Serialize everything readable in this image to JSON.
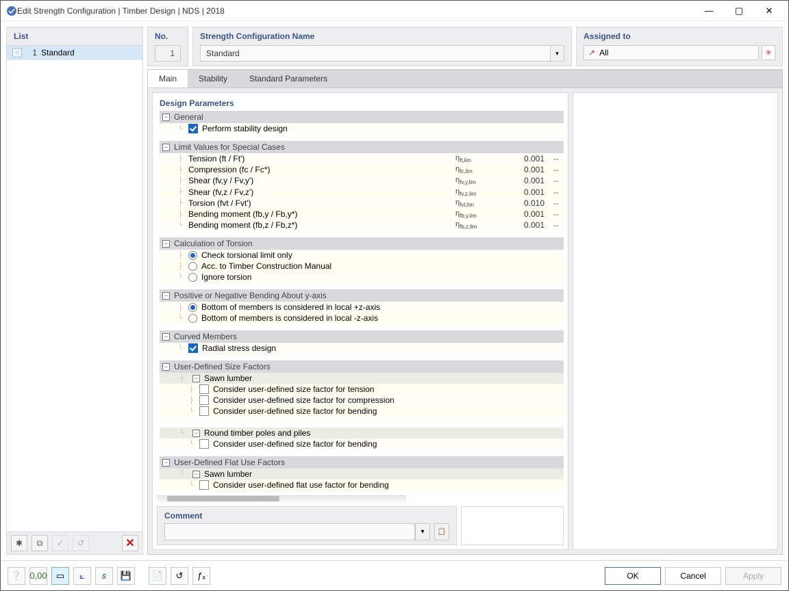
{
  "window": {
    "title": "Edit Strength Configuration | Timber Design | NDS | 2018"
  },
  "list": {
    "header": "List",
    "items": [
      {
        "num": "1",
        "label": "Standard"
      }
    ]
  },
  "header": {
    "no_label": "No.",
    "no_value": "1",
    "name_label": "Strength Configuration Name",
    "name_value": "Standard",
    "assigned_label": "Assigned to",
    "assigned_value": "All"
  },
  "tabs": {
    "main": "Main",
    "stability": "Stability",
    "standard": "Standard Parameters"
  },
  "form": {
    "title": "Design Parameters",
    "groups": {
      "general": {
        "title": "General",
        "perform_stability": "Perform stability design"
      },
      "limit": {
        "title": "Limit Values for Special Cases",
        "rows": [
          {
            "label": "Tension (ft / Ft')",
            "sym": "ηft,lim",
            "val": "0.001",
            "dash": "--"
          },
          {
            "label": "Compression (fc / Fc*)",
            "sym": "ηfc,lim",
            "val": "0.001",
            "dash": "--"
          },
          {
            "label": "Shear (fv,y / Fv,y')",
            "sym": "ηfv,y,lim",
            "val": "0.001",
            "dash": "--"
          },
          {
            "label": "Shear (fv,z / Fv,z')",
            "sym": "ηfv,z,lim",
            "val": "0.001",
            "dash": "--"
          },
          {
            "label": "Torsion (fvt / Fvt')",
            "sym": "ηfvt,lim",
            "val": "0.010",
            "dash": "--"
          },
          {
            "label": "Bending moment (fb,y / Fb,y*)",
            "sym": "ηfb,y,lim",
            "val": "0.001",
            "dash": "--"
          },
          {
            "label": "Bending moment (fb,z / Fb,z*)",
            "sym": "ηfb,z,lim",
            "val": "0.001",
            "dash": "--"
          }
        ]
      },
      "torsion": {
        "title": "Calculation of Torsion",
        "o1": "Check torsional limit only",
        "o2": "Acc. to Timber Construction Manual",
        "o3": "Ignore torsion"
      },
      "bending": {
        "title": "Positive or Negative Bending About y-axis",
        "o1": "Bottom of members is considered in local +z-axis",
        "o2": "Bottom of members is considered in local -z-axis"
      },
      "curved": {
        "title": "Curved Members",
        "radial": "Radial stress design"
      },
      "size": {
        "title": "User-Defined Size Factors",
        "sawn": "Sawn lumber",
        "s1": "Consider user-defined size factor for tension",
        "s2": "Consider user-defined size factor for compression",
        "s3": "Consider user-defined size factor for bending",
        "round": "Round timber poles and piles",
        "r1": "Consider user-defined size factor for bending"
      },
      "flat": {
        "title": "User-Defined Flat Use Factors",
        "sawn": "Sawn lumber",
        "f1": "Consider user-defined flat use factor for bending"
      }
    }
  },
  "comment": {
    "label": "Comment",
    "value": ""
  },
  "footer": {
    "ok": "OK",
    "cancel": "Cancel",
    "apply": "Apply"
  }
}
